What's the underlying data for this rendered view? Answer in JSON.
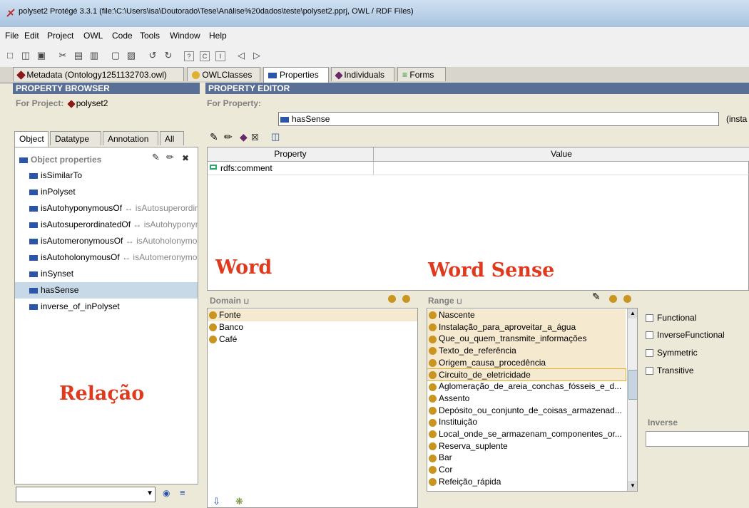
{
  "window": {
    "title": "polyset2  Protégé 3.3.1    (file:\\C:\\Users\\isa\\Doutorado\\Tese\\Análise%20dados\\teste\\polyset2.pprj, OWL / RDF Files)"
  },
  "menu": [
    "File",
    "Edit",
    "Project",
    "OWL",
    "Code",
    "Tools",
    "Window",
    "Help"
  ],
  "tabs": [
    {
      "label": "Metadata (Ontology1251132703.owl)",
      "icon": "diamond-icon"
    },
    {
      "label": "OWLClasses",
      "icon": "class-dot-icon"
    },
    {
      "label": "Properties",
      "icon": "property-icon",
      "active": true
    },
    {
      "label": "Individuals",
      "icon": "individual-diamond-icon"
    },
    {
      "label": "Forms",
      "icon": "forms-icon"
    }
  ],
  "browser": {
    "header": "PROPERTY BROWSER",
    "project_label": "For Project:",
    "project_name": "polyset2",
    "subtabs": [
      "Object",
      "Datatype",
      "Annotation",
      "All"
    ],
    "list_title": "Object properties",
    "properties": [
      {
        "name": "isSimilarTo",
        "inverse": ""
      },
      {
        "name": "inPolyset",
        "inverse": ""
      },
      {
        "name": "isAutohyponymousOf",
        "inverse": "↔ isAutosuperordinatedOf"
      },
      {
        "name": "isAutosuperordinatedOf",
        "inverse": "↔ isAutohyponymousOf"
      },
      {
        "name": "isAutomeronymousOf",
        "inverse": "↔ isAutoholonymousOf"
      },
      {
        "name": "isAutoholonymousOf",
        "inverse": "↔ isAutomeronymousOf"
      },
      {
        "name": "inSynset",
        "inverse": ""
      },
      {
        "name": "hasSense",
        "inverse": "",
        "selected": true
      },
      {
        "name": "inverse_of_inPolyset",
        "inverse": ""
      }
    ],
    "annotation_label": "Relação"
  },
  "editor": {
    "header": "PROPERTY EDITOR",
    "for_property_label": "For Property:",
    "property_name": "hasSense",
    "instance_hint": "(insta",
    "table_headers": {
      "property": "Property",
      "value": "Value"
    },
    "table_rows": [
      {
        "property": "rdfs:comment",
        "value": ""
      }
    ],
    "word_label": "Word",
    "word_sense_label": "Word Sense",
    "domain_title": "Domain",
    "domain_items": [
      "Fonte",
      "Banco",
      "Café"
    ],
    "range_title": "Range",
    "range_items": [
      "Nascente",
      "Instalação_para_aproveitar_a_água",
      "Que_ou_quem_transmite_informações",
      "Texto_de_referência",
      "Origem_causa_procedência",
      "Circuito_de_eletricidade",
      "Aglomeração_de_areia_conchas_fósseis_e_d...",
      "Assento",
      "Depósito_ou_conjunto_de_coisas_armazenad...",
      "Instituição",
      "Local_onde_se_armazenam_componentes_or...",
      "Reserva_suplente",
      "Bar",
      "Cor",
      "Refeição_rápida"
    ],
    "checkboxes": [
      "Functional",
      "InverseFunctional",
      "Symmetric",
      "Transitive"
    ],
    "inverse_label": "Inverse"
  },
  "colors": {
    "header_bg": "#5a6f96",
    "annotation_red": "#e03a1e",
    "class_dot": "#c99520",
    "property_blue": "#2a55a8"
  }
}
